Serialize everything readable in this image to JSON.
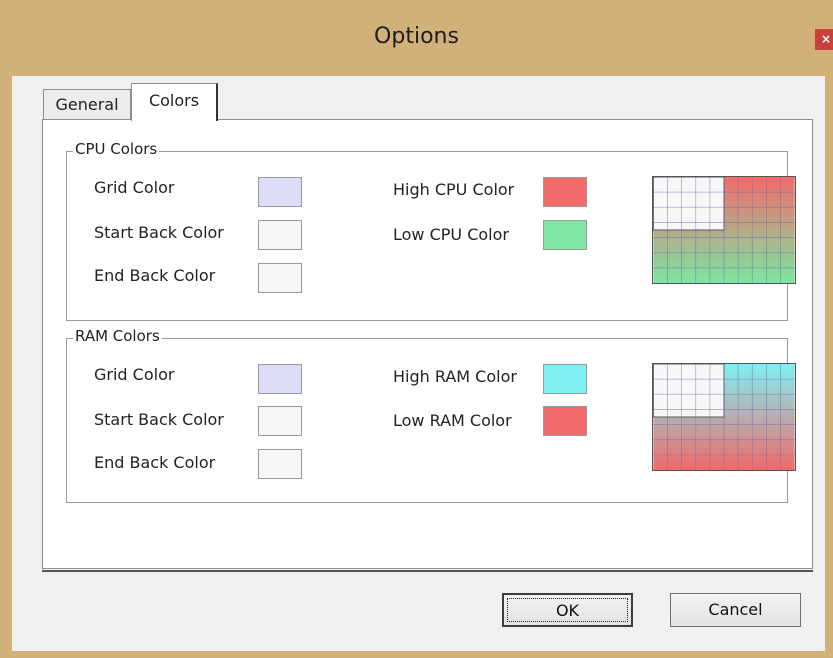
{
  "window": {
    "title": "Options",
    "close_glyph": "×"
  },
  "tabs": [
    {
      "label": "General",
      "selected": false
    },
    {
      "label": "Colors",
      "selected": true
    }
  ],
  "cpu": {
    "group_title": "CPU Colors",
    "grid_color_label": "Grid Color",
    "start_back_label": "Start Back Color",
    "end_back_label": "End Back Color",
    "high_label": "High CPU Color",
    "low_label": "Low CPU Color",
    "colors": {
      "grid": "#dcdcf6",
      "start_back": "#f7f7f7",
      "end_back": "#f7f7f7",
      "high": "#f26c6c",
      "low": "#7de6a2"
    }
  },
  "ram": {
    "group_title": "RAM Colors",
    "grid_color_label": "Grid Color",
    "start_back_label": "Start Back Color",
    "end_back_label": "End Back Color",
    "high_label": "High RAM Color",
    "low_label": "Low RAM Color",
    "colors": {
      "grid": "#dcdcf6",
      "start_back": "#f7f7f7",
      "end_back": "#f7f7f7",
      "high": "#7ff0f4",
      "low": "#f26a6a"
    }
  },
  "buttons": {
    "ok": "OK",
    "cancel": "Cancel"
  }
}
